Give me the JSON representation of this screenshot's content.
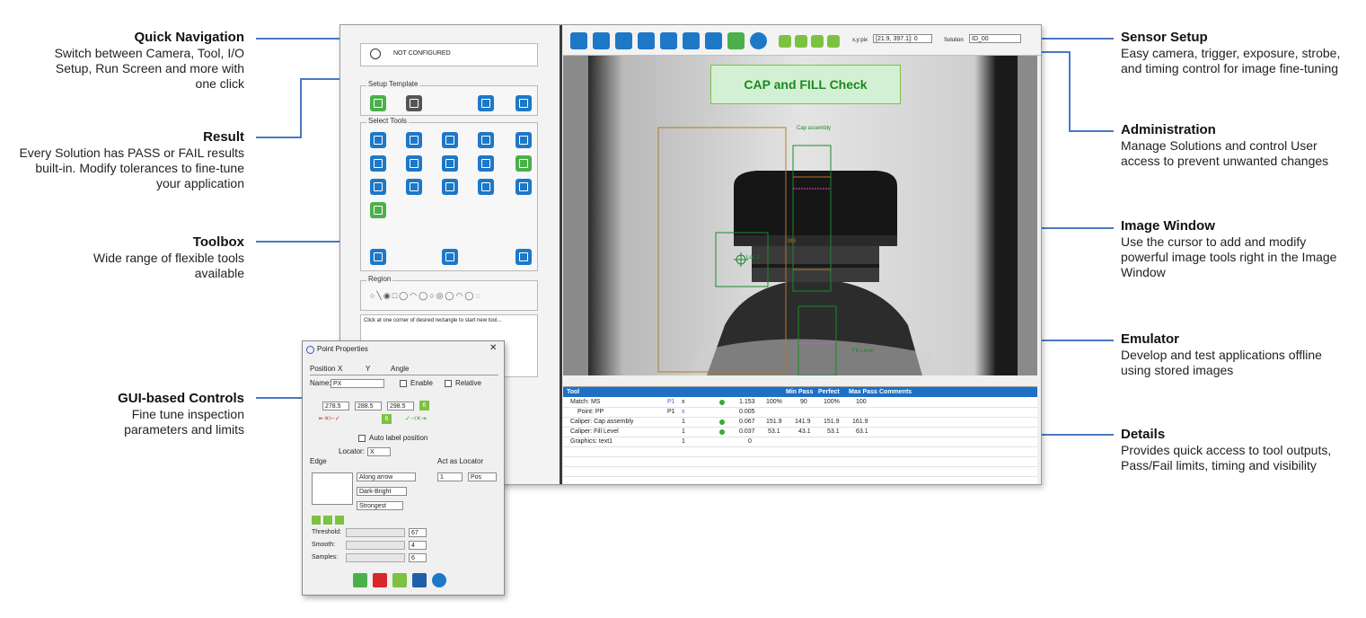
{
  "callouts": {
    "quick_nav": {
      "title": "Quick Navigation",
      "body": "Switch between Camera, Tool, I/O Setup, Run Screen and more with one click"
    },
    "result": {
      "title": "Result",
      "body": "Every Solution has PASS or FAIL results built-in.  Modify tolerances to fine-tune your application"
    },
    "toolbox": {
      "title": "Toolbox",
      "body": "Wide range of flexible tools available"
    },
    "gui": {
      "title": "GUI-based Controls",
      "body": "Fine tune inspection parameters and limits"
    },
    "sensor": {
      "title": "Sensor Setup",
      "body": "Easy camera, trigger, exposure, strobe, and timing control for image fine-tuning"
    },
    "admin": {
      "title": "Administration",
      "body": "Manage Solutions and control User access to prevent unwanted changes"
    },
    "image_window": {
      "title": "Image Window",
      "body": "Use the cursor to add and modify powerful image tools right in the Image Window"
    },
    "emulator": {
      "title": "Emulator",
      "body": "Develop and test applications offline using stored images"
    },
    "details": {
      "title": "Details",
      "body": "Provides quick access to tool outputs, Pass/Fail limits, timing and visibility"
    }
  },
  "app": {
    "status": "NOT CONFIGURED",
    "setup_template": "Setup Template",
    "select_tools": "Select Tools",
    "region": "Region",
    "hint": "Click at one corner of desired rectangle to start new tool...",
    "xy_label": "x,y:pix",
    "xy_value": "[21.9, 397.1]: 0",
    "solution_label": "Solution",
    "solution_value": "ID_00",
    "result_banner": "CAP and FILL Check",
    "cap_label": "Cap assembly",
    "ms_label": "MS",
    "loc_label": "Loc 1",
    "fill_label": "Fill Level",
    "accent": "#1e78c8",
    "pass_color": "#7cc142"
  },
  "table": {
    "headers": [
      "Tool",
      "",
      "",
      "",
      "",
      "",
      "",
      "",
      "",
      "Min Pass",
      "Perfect",
      "Max Pass",
      "Comments"
    ],
    "rows": [
      [
        "Match: MS",
        "P1",
        "x",
        "",
        "",
        "",
        "1.153",
        "100%",
        "90",
        "100%",
        "100"
      ],
      [
        "Point: PP",
        "P1",
        "x",
        "",
        "",
        "",
        "0.005",
        "",
        "",
        "",
        ""
      ],
      [
        "Caliper: Cap assembly",
        "",
        "1",
        "",
        "",
        "",
        "0.067",
        "151.9",
        "141.9",
        "151.9",
        "161.9"
      ],
      [
        "Caliper: Fill Level",
        "",
        "1",
        "",
        "",
        "",
        "0.037",
        "53.1",
        "43.1",
        "53.1",
        "63.1"
      ],
      [
        "Graphics: text1",
        "",
        "1",
        "",
        "",
        "",
        "0",
        "",
        "",
        "",
        ""
      ]
    ]
  },
  "dialog": {
    "title": "Point Properties",
    "tab_position": "Position",
    "tab_x": "X",
    "tab_y": "Y",
    "tab_angle": "Angle",
    "name_label": "Name:",
    "name_value": "PX",
    "enable_label": "Enable",
    "relative_label": "Relative",
    "v1": "278.5",
    "v2": "288.5",
    "v3": "298.5",
    "badge1": "6",
    "badge2": "6",
    "auto_label": "Auto label position",
    "locator_label": "Locator:",
    "locator_value": "X",
    "act_label": "Act as Locator",
    "act_value": "1",
    "pos_value": "Pos",
    "edge_label": "Edge",
    "edge_opt1": "Along arrow",
    "edge_opt2": "Dark-Bright",
    "edge_opt3": "Strongest",
    "threshold_label": "Threshold:",
    "threshold_value": "67",
    "smooth_label": "Smooth:",
    "smooth_value": "4",
    "samples_label": "Samples:",
    "samples_value": "6",
    "close": "✕"
  }
}
